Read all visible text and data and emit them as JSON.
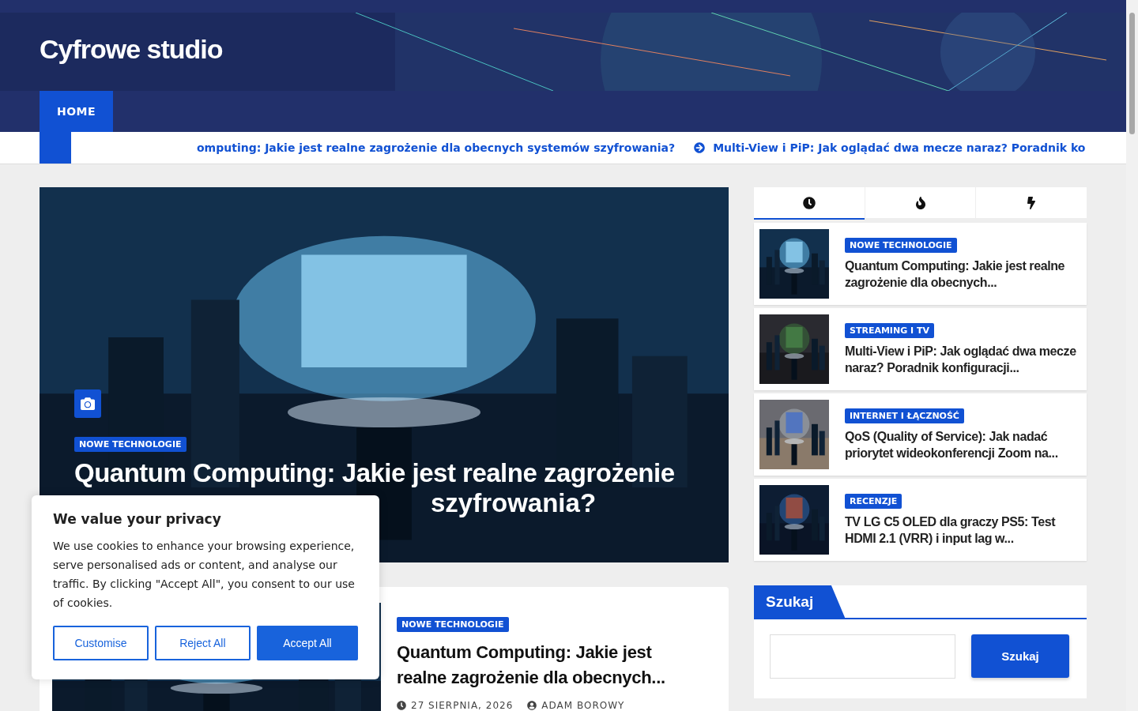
{
  "site_title": "Cyfrowe studio",
  "nav": [
    {
      "label": "HOME",
      "selected": true
    }
  ],
  "ticker": [
    {
      "text": "omputing: Jakie jest realne zagrożenie dla obecnych systemów szyfrowania?",
      "icon": false
    },
    {
      "text": "Multi-View i PiP: Jak oglądać dwa mecze naraz? Poradnik ko",
      "icon": true
    }
  ],
  "hero": {
    "category": "NOWE TECHNOLOGIE",
    "title_lines": [
      "Quantum Computing: Jakie jest realne zagrożenie",
      "szyfrowania?"
    ]
  },
  "sidebar_tabs": [
    {
      "kind": "recent",
      "selected": true
    },
    {
      "kind": "popular",
      "selected": false
    },
    {
      "kind": "trending",
      "selected": false
    }
  ],
  "sidebar_posts": [
    {
      "category": "NOWE TECHNOLOGIE",
      "title": "Quantum Computing: Jakie jest realne zagrożenie dla obecnych..."
    },
    {
      "category": "STREAMING I TV",
      "title": "Multi-View i PiP: Jak oglądać dwa mecze naraz? Poradnik konfiguracji..."
    },
    {
      "category": "INTERNET I ŁĄCZNOŚĆ",
      "title": "QoS (Quality of Service): Jak nadać priorytet wideokonferencji Zoom na..."
    },
    {
      "category": "RECENZJE",
      "title": "TV LG C5 OLED dla graczy PS5: Test HDMI 2.1 (VRR) i input lag w..."
    }
  ],
  "search_widget": {
    "title": "Szukaj",
    "button": "Szukaj"
  },
  "post": {
    "category": "NOWE TECHNOLOGIE",
    "title": "Quantum Computing: Jakie jest realne zagrożenie dla obecnych...",
    "date": "27 SIERPNIA, 2026",
    "author": "ADAM BOROWY"
  },
  "cookie": {
    "title": "We value your privacy",
    "text": "We use cookies to enhance your browsing experience, serve personalised ads or content, and analyse our traffic. By clicking \"Accept All\", you consent to our use of cookies.",
    "buttons": [
      {
        "label": "Customise",
        "kind": "outline"
      },
      {
        "label": "Reject All",
        "kind": "outline"
      },
      {
        "label": "Accept All",
        "kind": "primary"
      }
    ]
  }
}
